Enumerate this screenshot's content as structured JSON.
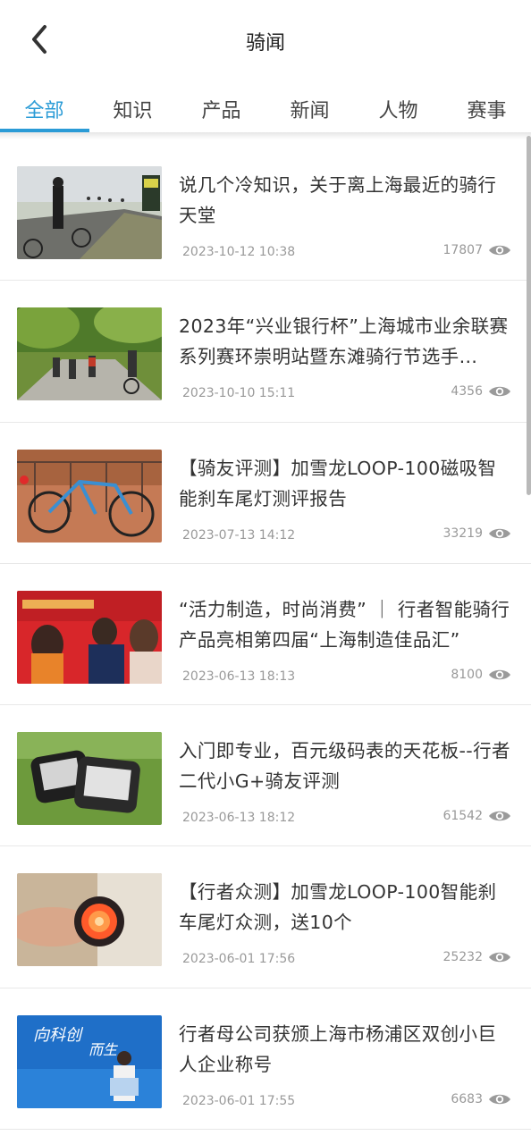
{
  "header": {
    "title": "骑闻"
  },
  "tabs": [
    {
      "label": "全部",
      "active": true
    },
    {
      "label": "知识"
    },
    {
      "label": "产品"
    },
    {
      "label": "新闻"
    },
    {
      "label": "人物"
    },
    {
      "label": "赛事"
    }
  ],
  "articles": [
    {
      "title": "说几个冷知识，关于离上海最近的骑行天堂",
      "date": "2023-10-12 10:38",
      "views": "17807",
      "thumb": "cyclist-road-sign"
    },
    {
      "title": "2023年“兴业银行杯”上海城市业余联赛系列赛环崇明站暨东滩骑行节选手…",
      "date": "2023-10-10 15:11",
      "views": "4356",
      "thumb": "cycling-group-trees"
    },
    {
      "title": "【骑友评测】加雪龙LOOP-100磁吸智能刹车尾灯测评报告",
      "date": "2023-07-13 14:12",
      "views": "33219",
      "thumb": "road-bike-railing"
    },
    {
      "title": "“活力制造，时尚消费” ｜ 行者智能骑行产品亮相第四届“上海制造佳品汇”",
      "date": "2023-06-13 18:13",
      "views": "8100",
      "thumb": "event-speakers-red"
    },
    {
      "title": "入门即专业，百元级码表的天花板--行者二代小G+骑友评测",
      "date": "2023-06-13 18:12",
      "views": "61542",
      "thumb": "bike-computers-grass"
    },
    {
      "title": "【行者众测】加雪龙LOOP-100智能刹车尾灯众测，送10个",
      "date": "2023-06-01 17:56",
      "views": "25232",
      "thumb": "tail-light-hand"
    },
    {
      "title": "行者母公司获颁上海市杨浦区双创小巨人企业称号",
      "date": "2023-06-01 17:55",
      "views": "6683",
      "thumb": "award-blue-stage"
    }
  ],
  "colors": {
    "accent": "#2a9bd6",
    "meta": "#999999"
  }
}
